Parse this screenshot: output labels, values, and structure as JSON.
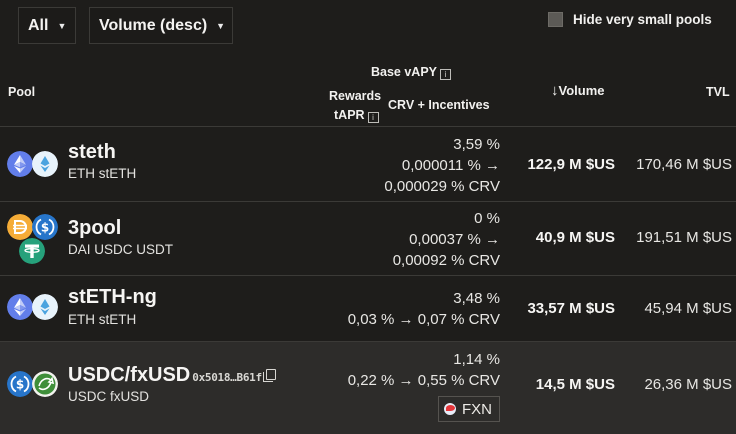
{
  "toolbar": {
    "filter_value": "All",
    "sort_value": "Volume (desc)",
    "hide_small_label": "Hide very small pools",
    "hide_small_checked": false
  },
  "table": {
    "headers": {
      "pool": "Pool",
      "base_vapy": "Base vAPY",
      "rewards": "Rewards",
      "tapr": "tAPR",
      "crv_incentives": "CRV + Incentives",
      "volume_arrow": "↓",
      "volume": "Volume",
      "tvl": "TVL"
    },
    "rows": [
      {
        "name": "steth",
        "tokens": "ETH stETH",
        "apy_line1": "3,59 %",
        "apy_line2": "0,000011 % →",
        "apy_line3": "0,000029 % CRV",
        "volume": "122,9 M $US",
        "tvl": "170,46 M $US",
        "coin_icons": [
          "eth-icon",
          "steth-icon"
        ]
      },
      {
        "name": "3pool",
        "tokens": "DAI USDC USDT",
        "apy_line1": "0 %",
        "apy_line2": "0,00037 % →",
        "apy_line3": "0,00092 % CRV",
        "volume": "40,9 M $US",
        "tvl": "191,51 M $US",
        "coin_icons": [
          "dai-icon",
          "usdc-icon",
          "usdt-icon"
        ]
      },
      {
        "name": "stETH-ng",
        "tokens": "ETH stETH",
        "apy_line1": "3,48 %",
        "apy_line2": "0,03 % → 0,07 % CRV",
        "volume": "33,57 M $US",
        "tvl": "45,94 M $US",
        "coin_icons": [
          "eth-icon",
          "steth-icon"
        ]
      },
      {
        "name": "USDC/fxUSD",
        "address": "0x5018…B61f",
        "tokens": "USDC fxUSD",
        "apy_line1": "1,14 %",
        "apy_line2": "0,22 % → 0,55 % CRV",
        "badge": "FXN",
        "volume": "14,5 M $US",
        "tvl": "26,36 M $US",
        "coin_icons": [
          "usdc-icon",
          "fxusd-icon"
        ]
      }
    ]
  },
  "colors": {
    "background": "#1e1d1b",
    "row_highlight": "#2d2c2a",
    "border": "#3b3a37",
    "eth_blue": "#627eea",
    "steth_light": "#e8f3fb",
    "dai_orange": "#f5ac37",
    "usdc_blue": "#2775ca",
    "usdt_green": "#26a17b",
    "fxusd_green": "#3f8f3a"
  }
}
